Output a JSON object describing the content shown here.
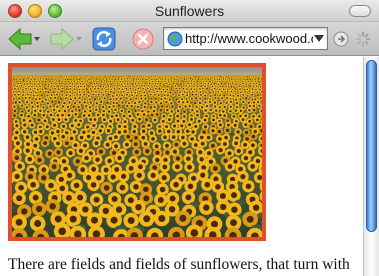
{
  "window": {
    "title": "Sunflowers"
  },
  "toolbar": {
    "url": "http://www.cookwood.com/html/examples/sunflowers.html",
    "icons": [
      "back-arrow-icon",
      "forward-arrow-icon",
      "reload-icon",
      "stop-icon",
      "globe-icon",
      "dropdown-arrow-icon",
      "go-icon",
      "loading-spinner-icon"
    ]
  },
  "content": {
    "image_border_color": "#e0502b",
    "paragraph": "There are fields and fields of sunflowers, that turn with"
  },
  "colors": {
    "accent_blue": "#3f7fd6",
    "stop_red": "#f05a5a",
    "back_green": "#5cb83a"
  }
}
